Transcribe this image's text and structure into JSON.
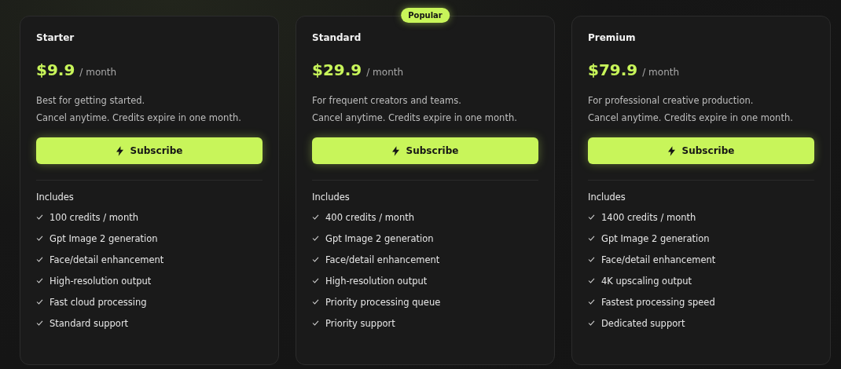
{
  "plans": [
    {
      "name": "Starter",
      "price": "$9.9",
      "period": "/ month",
      "description": [
        "Best for getting started.",
        "Cancel anytime. Credits expire in one month."
      ],
      "button": "Subscribe",
      "includes_label": "Includes",
      "features": [
        "100 credits / month",
        "Gpt Image 2 generation",
        "Face/detail enhancement",
        "High-resolution output",
        "Fast cloud processing",
        "Standard support"
      ]
    },
    {
      "name": "Standard",
      "badge": "Popular",
      "price": "$29.9",
      "period": "/ month",
      "description": [
        "For frequent creators and teams.",
        "Cancel anytime. Credits expire in one month."
      ],
      "button": "Subscribe",
      "includes_label": "Includes",
      "features": [
        "400 credits / month",
        "Gpt Image 2 generation",
        "Face/detail enhancement",
        "High-resolution output",
        "Priority processing queue",
        "Priority support"
      ]
    },
    {
      "name": "Premium",
      "price": "$79.9",
      "period": "/ month",
      "description": [
        "For professional creative production.",
        "Cancel anytime. Credits expire in one month."
      ],
      "button": "Subscribe",
      "includes_label": "Includes",
      "features": [
        "1400 credits / month",
        "Gpt Image 2 generation",
        "Face/detail enhancement",
        "4K upscaling output",
        "Fastest processing speed",
        "Dedicated support"
      ]
    }
  ]
}
